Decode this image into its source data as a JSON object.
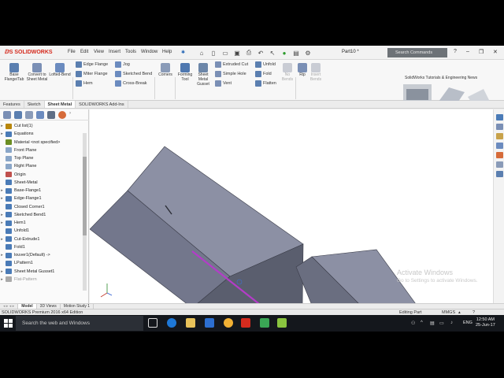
{
  "app": {
    "brand": "SOLIDWORKS",
    "document": "Part10 *",
    "menus": [
      "File",
      "Edit",
      "View",
      "Insert",
      "Tools",
      "Window",
      "Help"
    ],
    "search_placeholder": "Search Commands"
  },
  "ribbon": {
    "large": [
      {
        "label": "Base Flange/Tab",
        "icon": "base-flange-icon"
      },
      {
        "label": "Convert to Sheet Metal",
        "icon": "convert-sheet-metal-icon"
      },
      {
        "label": "Lofted-Bend",
        "icon": "lofted-bend-icon"
      },
      {
        "label": "Corners",
        "icon": "corners-icon"
      },
      {
        "label": "Forming Tool",
        "icon": "forming-tool-icon"
      },
      {
        "label": "Sheet Metal Gusset",
        "icon": "gusset-icon"
      },
      {
        "label": "No Bends",
        "icon": "no-bends-icon"
      },
      {
        "label": "Insert Bends",
        "icon": "insert-bends-icon"
      },
      {
        "label": "Rip",
        "icon": "rip-icon"
      }
    ],
    "small_col1": [
      "Edge Flange",
      "Miter Flange",
      "Hem"
    ],
    "small_col2": [
      "Jog",
      "Sketched Bend",
      "Cross-Break"
    ],
    "small_col3": [
      "Extruded Cut",
      "Simple Hole",
      "Vent"
    ],
    "small_col4": [
      "Unfold",
      "Fold",
      "Flatten"
    ],
    "news_title": "SolidWorks Tutorials & Engineering News"
  },
  "tabs": [
    "Features",
    "Sketch",
    "Sheet Metal",
    "SOLIDWORKS Add-Ins"
  ],
  "active_tab": "Sheet Metal",
  "tree": [
    {
      "label": "Cut list(1)",
      "arrow": "▸",
      "color": "#b8860b"
    },
    {
      "label": "Equations",
      "arrow": "▸",
      "color": "#4a7bb7"
    },
    {
      "label": "Material <not specified>",
      "arrow": "",
      "color": "#6b8e23"
    },
    {
      "label": "Front Plane",
      "arrow": "",
      "color": "#8aa6c8"
    },
    {
      "label": "Top Plane",
      "arrow": "",
      "color": "#8aa6c8"
    },
    {
      "label": "Right Plane",
      "arrow": "",
      "color": "#8aa6c8"
    },
    {
      "label": "Origin",
      "arrow": "",
      "color": "#c0504d"
    },
    {
      "label": "Sheet-Metal",
      "arrow": "",
      "color": "#4a7bb7"
    },
    {
      "label": "Base-Flange1",
      "arrow": "▸",
      "color": "#4a7bb7"
    },
    {
      "label": "Edge-Flange1",
      "arrow": "▸",
      "color": "#4a7bb7"
    },
    {
      "label": "Closed Corner1",
      "arrow": "",
      "color": "#4a7bb7"
    },
    {
      "label": "Sketched Bend1",
      "arrow": "▸",
      "color": "#4a7bb7"
    },
    {
      "label": "Hem1",
      "arrow": "▸",
      "color": "#4a7bb7"
    },
    {
      "label": "Unfold1",
      "arrow": "",
      "color": "#4a7bb7"
    },
    {
      "label": "Cut-Extrude1",
      "arrow": "▸",
      "color": "#4a7bb7"
    },
    {
      "label": "Fold1",
      "arrow": "",
      "color": "#4a7bb7"
    },
    {
      "label": "louver1(Default) ->",
      "arrow": "▸",
      "color": "#4a7bb7"
    },
    {
      "label": "LPattern1",
      "arrow": "",
      "color": "#4a7bb7"
    },
    {
      "label": "Sheet Metal Gusset1",
      "arrow": "▸",
      "color": "#4a7bb7"
    },
    {
      "label": "Flat-Pattern",
      "arrow": "▸",
      "color": "#aaaaaa"
    }
  ],
  "model_tabs": [
    "Model",
    "3D Views",
    "Motion Study 1"
  ],
  "status": {
    "edition": "SOLIDWORKS Premium 2016 x64 Edition",
    "mode": "Editing Part",
    "units": "MMGS"
  },
  "watermark": {
    "line1": "Activate Windows",
    "line2": "Go to Settings to activate Windows."
  },
  "taskbar": {
    "search_placeholder": "Search the web and Windows",
    "lang": "ENG",
    "time": "12:50 AM",
    "date": "25-Jun-17"
  },
  "colors": {
    "accent_red": "#d52b1e",
    "part_face": "#8c90a4",
    "part_dark": "#5a5e6e",
    "edge_highlight": "#b43cc8"
  }
}
